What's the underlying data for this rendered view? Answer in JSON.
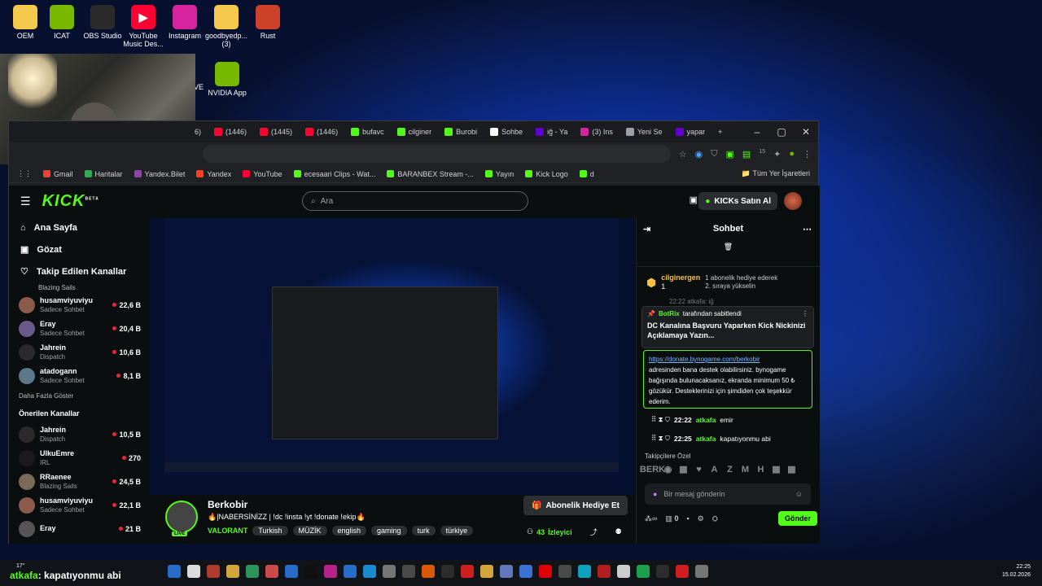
{
  "desktop": {
    "icons": [
      {
        "label": "OEM",
        "color": "#f3c84b",
        "glyph": ""
      },
      {
        "label": "ICAT",
        "color": "#76b900",
        "glyph": ""
      },
      {
        "label": "OBS Studio",
        "color": "#2b2b2b",
        "glyph": ""
      },
      {
        "label": "YouTube Music Des...",
        "color": "#ff0033",
        "glyph": "▶"
      },
      {
        "label": "Instagram",
        "color": "#d6249f",
        "glyph": ""
      },
      {
        "label": "goodbyedp... (3)",
        "color": "#f3c84b",
        "glyph": ""
      },
      {
        "label": "Rust",
        "color": "#cd412b",
        "glyph": ""
      }
    ],
    "nvidia_label": "NVIDIA App",
    "left_stub": "VE"
  },
  "browser": {
    "tabs": [
      {
        "label": "(1446)",
        "color": "#ff0033"
      },
      {
        "label": "(1445)",
        "color": "#ff0033"
      },
      {
        "label": "(1446)",
        "color": "#ff0033"
      },
      {
        "label": "bufavc",
        "color": "#53fc18"
      },
      {
        "label": "cilginer",
        "color": "#53fc18"
      },
      {
        "label": "Burobi",
        "color": "#53fc18"
      },
      {
        "label": "Sohbe",
        "color": "#ffffff"
      },
      {
        "label": "iğ - Ya",
        "color": "#6001d2"
      },
      {
        "label": "(3) Ins",
        "color": "#d6249f"
      },
      {
        "label": "Yeni Se",
        "color": "#9aa0a6"
      },
      {
        "label": "yapar",
        "color": "#6001d2"
      }
    ],
    "tab_first_stub": "6)",
    "new_tab_glyph": "+",
    "bookmarks": [
      {
        "label": "Gmail",
        "color": "#ea4335"
      },
      {
        "label": "Haritalar",
        "color": "#34a853"
      },
      {
        "label": "Yandex.Bilet",
        "color": "#8e44ad"
      },
      {
        "label": "Yandex",
        "color": "#fc3f1d"
      },
      {
        "label": "YouTube",
        "color": "#ff0033"
      },
      {
        "label": "ecesaari Clips - Wat...",
        "color": "#53fc18"
      },
      {
        "label": "BARANBEX Stream -...",
        "color": "#53fc18"
      },
      {
        "label": "Yayın",
        "color": "#53fc18"
      },
      {
        "label": "Kick Logo",
        "color": "#53fc18"
      },
      {
        "label": "d",
        "color": "#53fc18"
      }
    ],
    "all_bookmarks": "Tüm Yer İşaretleri",
    "ext_badge": "15"
  },
  "kick": {
    "logo": "KICK",
    "logo_sup": "BETA",
    "search_placeholder": "Ara",
    "buy_label": "KICKs Satın Al",
    "nav": [
      {
        "label": "Ana Sayfa",
        "icon": "⌂"
      },
      {
        "label": "Gözat",
        "icon": "▣"
      },
      {
        "label": "Takip Edilen Kanallar",
        "icon": "♡"
      }
    ],
    "partial_top": "Blazing Sails",
    "followed": [
      {
        "name": "husamviyuviyu",
        "sub": "Sadece Sohbet",
        "viewers": "22,6 B",
        "av": "#8a5a4a"
      },
      {
        "name": "Eray",
        "sub": "Sadece Sohbet",
        "viewers": "20,4 B",
        "av": "#6a5a8a"
      },
      {
        "name": "Jahrein",
        "sub": "Dispatch",
        "viewers": "10,6 B",
        "av": "#2a2a2a"
      },
      {
        "name": "atadogann",
        "sub": "Sadece Sohbet",
        "viewers": "8,1 B",
        "av": "#5a7a8a"
      }
    ],
    "show_more": "Daha Fazla Göster",
    "recommended_title": "Önerilen Kanallar",
    "recommended": [
      {
        "name": "Jahrein",
        "sub": "Dispatch",
        "viewers": "10,5 B",
        "av": "#2a2a2a"
      },
      {
        "name": "UlkuEmre",
        "sub": "IRL",
        "viewers": "270",
        "av": "#1a1a1a"
      },
      {
        "name": "RRaenee",
        "sub": "Blazing Sails",
        "viewers": "24,5 B",
        "av": "#7a6a5a"
      },
      {
        "name": "husamviyuviyu",
        "sub": "Sadece Sohbet",
        "viewers": "22,1 B",
        "av": "#8a5a4a"
      }
    ],
    "partial_bottom": {
      "name": "Eray",
      "viewers": "21 B"
    },
    "stream": {
      "name": "Berkobir",
      "title": "🔥|NABERSİNİZZ | !dc !insta !yt !donate !ekip🔥",
      "game": "VALORANT",
      "tags": [
        "Turkish",
        "MÜZİK",
        "english",
        "gaming",
        "turk",
        "türkiye"
      ],
      "live_badge": "LIVE",
      "sub_button": "Abonelik Hediye Et",
      "viewer_count": "43",
      "viewer_word": "İzleyici"
    },
    "chat": {
      "title": "Sohbet",
      "gift_user": "cilginergen",
      "gift_count": "1",
      "gift_text": "1 abonelik hediye ederek 2. sıraya yükselin",
      "pinned_by": "BotRix",
      "pinned_suffix": "tarafından sabitlendi",
      "pinned_text": "DC Kanalına Başvuru Yaparken Kick Nickinizi Açıklamaya Yazın...",
      "behind_pin": "22:22 atkafa: iğ",
      "donate_link": "https://donate.bynogame.com/berkobir",
      "donate_text": "adresinden bana destek olabilirsiniz. bynogame bağışında bulunacaksanız, ekranda minimum 50 ₺ gözükür. Desteklerinizi için şimdiden çok teşekkür ederim.",
      "messages": [
        {
          "time": "22:22",
          "user": "atkafa",
          "text": "emir"
        },
        {
          "time": "22:25",
          "user": "atkafa",
          "text": "kapatıyonmu abi"
        }
      ],
      "emote_label": "Takipçilere Özel",
      "emotes": [
        "BERK",
        "◉",
        "▦",
        "♥",
        "A",
        "Z",
        "M",
        "H",
        "▦",
        "▦"
      ],
      "input_placeholder": "Bir mesaj gönderin",
      "bottom_count": "0",
      "send": "Gönder"
    }
  },
  "overlay": {
    "user": "atkafa",
    "text": ": kapatıyonmu abi",
    "badge": "17°"
  },
  "taskbar": {
    "time": "22:25",
    "date": "15.02.2026",
    "icons": [
      "#2b7de9",
      "#fff",
      "#c43",
      "#f6c142",
      "#3a6",
      "#e55",
      "#2b7de9",
      "#111",
      "#d6249f",
      "#2b7de9",
      "#1da1f2",
      "#888",
      "#555",
      "#f60",
      "#333",
      "#e22",
      "#f6c142",
      "#7289da",
      "#4285f4",
      "#f00",
      "#555",
      "#1bd",
      "#c22",
      "#eee",
      "#1db954",
      "#333",
      "#e22",
      "#888"
    ]
  }
}
